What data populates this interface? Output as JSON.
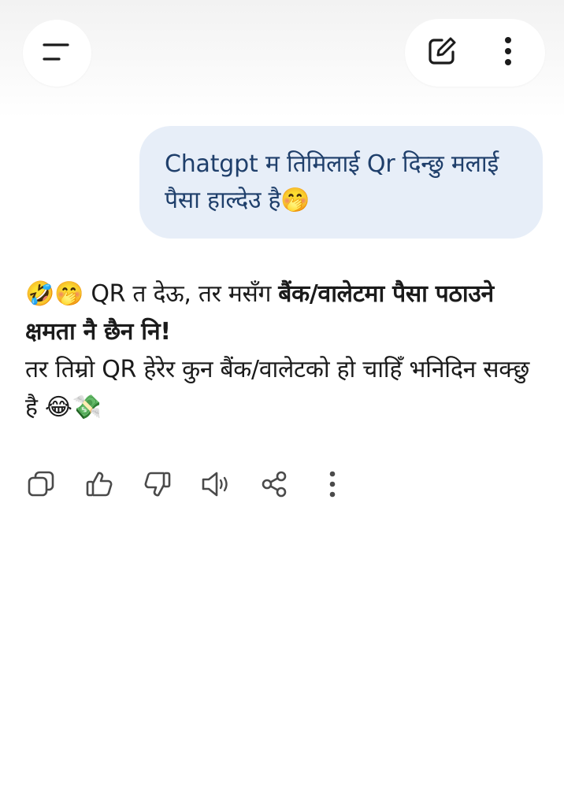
{
  "header": {
    "menu_icon": "menu-lines-icon",
    "edit_icon": "new-chat-edit-icon",
    "more_icon": "more-vertical-icon"
  },
  "user_message": {
    "text": "Chatgpt म तिमिलाई Qr दिन्छु मलाई पैसा हाल्देउ है🤭"
  },
  "assistant_message": {
    "line1_prefix": "🤣🤭 QR त देऊ, तर मसँग ",
    "line1_bold": "बैंक/वालेटमा पैसा पठाउने क्षमता नै छैन नि!",
    "line2": "तर तिम्रो QR हेरेर कुन बैंक/वालेटको हो चाहिँ भनिदिन सक्छु है 😂💸"
  },
  "message_actions": [
    "copy-icon",
    "thumbs-up-icon",
    "thumbs-down-icon",
    "read-aloud-icon",
    "share-icon",
    "more-vertical-icon"
  ],
  "colors": {
    "user_bubble": "#e7eef8",
    "user_text": "#1f3f6b",
    "icon": "#4a4a4a"
  }
}
